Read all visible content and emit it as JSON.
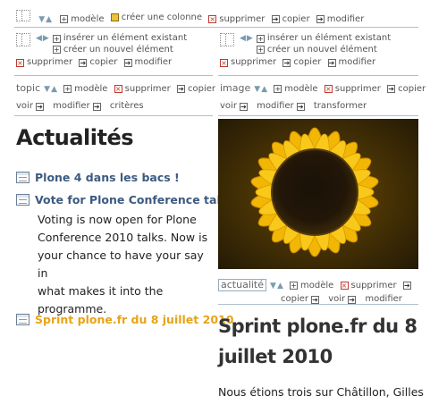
{
  "top_toolbar": {
    "model": "modèle",
    "create_column": "créer une colonne",
    "delete": "supprimer",
    "copy": "copier",
    "edit": "modifier"
  },
  "col_toolbar": {
    "insert_existing": "insérer un élément existant",
    "create_new": "créer un nouvel élément",
    "delete": "supprimer",
    "copy": "copier",
    "edit": "modifier"
  },
  "topic_toolbar": {
    "label": "topic",
    "model": "modèle",
    "delete": "supprimer",
    "copy": "copier",
    "view": "voir",
    "edit": "modifier",
    "criteria": "critères"
  },
  "image_toolbar": {
    "label": "image",
    "model": "modèle",
    "delete": "supprimer",
    "copy": "copier",
    "view": "voir",
    "edit": "modifier",
    "transform": "transformer"
  },
  "news": {
    "heading": "Actualités",
    "items": [
      {
        "title": "Plone 4 dans les bacs !"
      },
      {
        "title": "Vote for Plone Conference talks",
        "description": [
          "Voting is now open for Plone",
          "Conference 2010 talks. Now is",
          "your chance to have your say in",
          "what makes it into the",
          "programme."
        ]
      },
      {
        "title": "Sprint plone.fr du 8 juillet 2010"
      }
    ]
  },
  "news_item_toolbar": {
    "badge": "actualité",
    "model": "modèle",
    "delete": "supprimer",
    "copy": "copier",
    "view": "voir",
    "edit": "modifier"
  },
  "article": {
    "title_line1": "Sprint plone.fr du 8",
    "title_line2": "juillet 2010",
    "body": "Nous étions trois sur Châtillon, Gilles"
  },
  "colors": {
    "link_blue": "#3d5a80",
    "link_orange": "#e8a317",
    "rule": "#aebfcc"
  },
  "icons": {
    "add": "plus-box-icon",
    "delete": "x-box-icon",
    "copy": "arrow-box-icon",
    "move": "drag-handle-icon"
  }
}
